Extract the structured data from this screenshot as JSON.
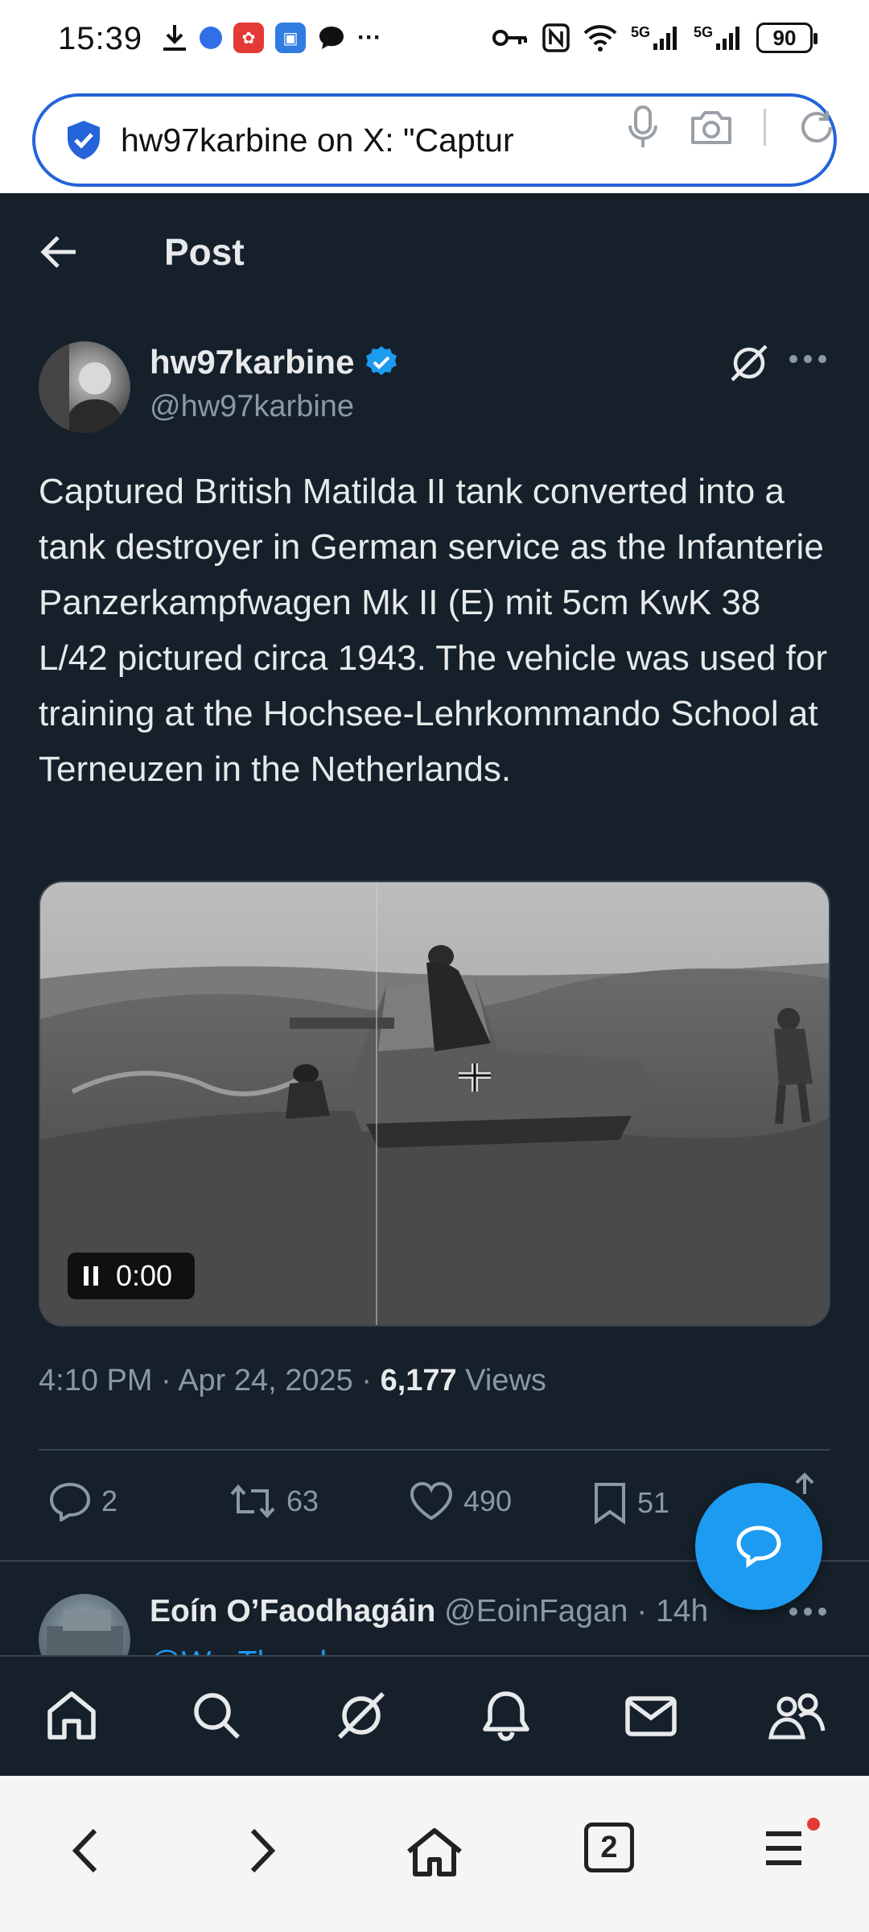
{
  "status_bar": {
    "time": "15:39",
    "signal_1": "5G",
    "signal_2": "5G",
    "battery": "90",
    "more": "···"
  },
  "browser": {
    "url_title": "hw97karbine on X: \"Captur"
  },
  "header": {
    "title": "Post"
  },
  "post": {
    "author_name": "hw97karbine",
    "author_handle": "@hw97karbine",
    "text": "Captured British Matilda II tank converted into a tank destroyer in German service as the Infanterie Panzerkampfwagen Mk II (E) mit 5cm KwK 38 L/42 pictured circa 1943. The vehicle was used for training at the Hochsee-Lehrkommando School at Terneuzen in the Netherlands.",
    "video_time": "0:00",
    "timestamp": "4:10 PM · Apr 24, 2025 · ",
    "views_count": "6,177",
    "views_label": " Views",
    "replies": "2",
    "reposts": "63",
    "likes": "490",
    "bookmarks": "51"
  },
  "reply": {
    "name": "Eoín O’Faodhagáin",
    "handle": " @EoinFagan · 14h",
    "snippet": "@WarThunder..."
  },
  "icons": {
    "accent": "#1d9bf0",
    "background": "#15202b",
    "verified_badge": "verified-badge-icon"
  },
  "system_nav": {
    "tabs_count": "2"
  }
}
